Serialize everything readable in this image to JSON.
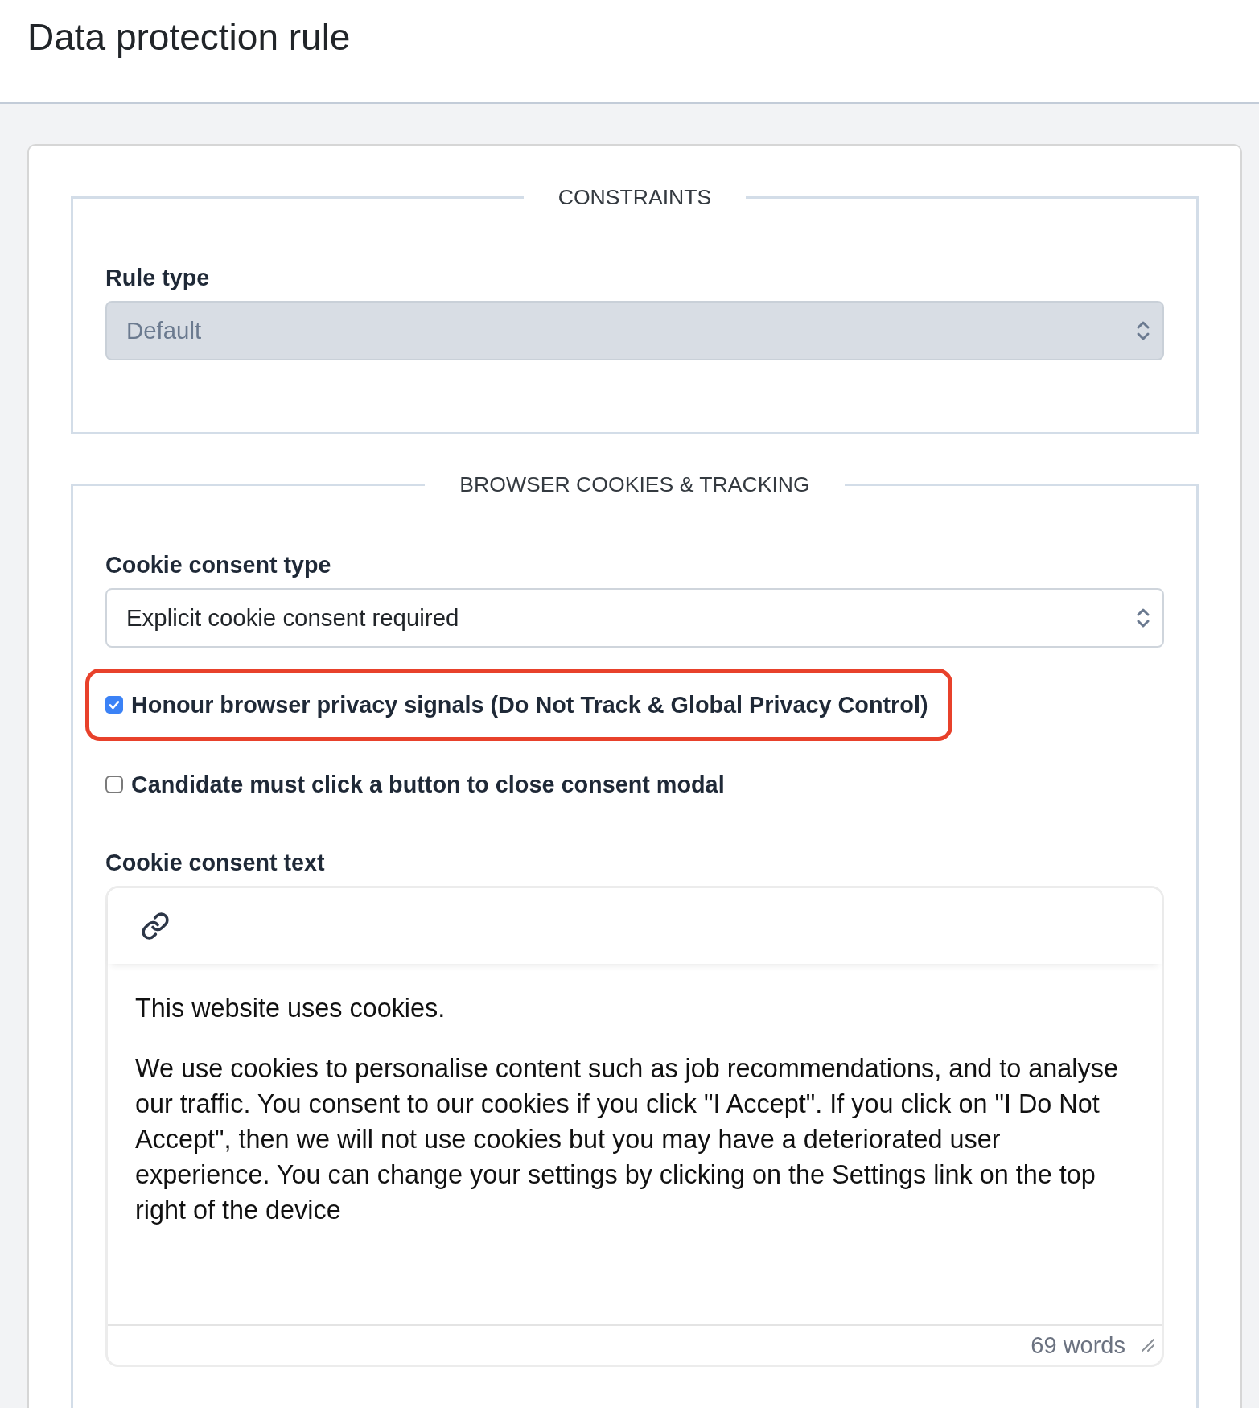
{
  "page": {
    "title": "Data protection rule"
  },
  "sections": [
    {
      "legend": "CONSTRAINTS",
      "fields": [
        {
          "kind": "select",
          "label": "Rule type",
          "value": "Default",
          "disabled": true
        }
      ]
    },
    {
      "legend": "BROWSER COOKIES & TRACKING",
      "fields": [
        {
          "kind": "select",
          "label": "Cookie consent type",
          "value": "Explicit cookie consent required",
          "disabled": false
        },
        {
          "kind": "checkbox",
          "label": "Honour browser privacy signals (Do Not Track & Global Privacy Control)",
          "checked": true,
          "highlighted": true
        },
        {
          "kind": "checkbox",
          "label": "Candidate must click a button to close consent modal",
          "checked": false,
          "highlighted": false
        },
        {
          "kind": "editor",
          "label": "Cookie consent text",
          "paragraphs": [
            "This website uses cookies.",
            "We use cookies to personalise content such as job recommendations, and to analyse our traffic. You consent to our cookies if you click \"I Accept\". If you click on \"I Do Not Accept\", then we will not use cookies but you may have a deteriorated user experience. You can change your settings by clicking on the Settings link on the top right of the device"
          ],
          "word_count": "69 words"
        }
      ]
    }
  ]
}
